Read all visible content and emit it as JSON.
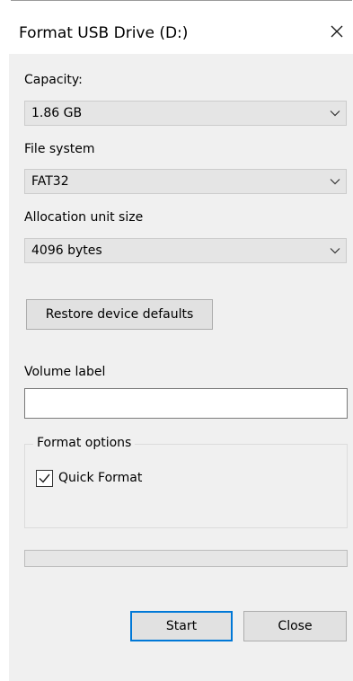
{
  "window": {
    "title": "Format USB Drive (D:)",
    "close_icon": "close-icon"
  },
  "capacity": {
    "label": "Capacity:",
    "value": "1.86 GB"
  },
  "file_system": {
    "label": "File system",
    "value": "FAT32"
  },
  "allocation": {
    "label": "Allocation unit size",
    "value": "4096 bytes"
  },
  "restore_button": "Restore device defaults",
  "volume": {
    "label": "Volume label",
    "value": ""
  },
  "format_options": {
    "legend": "Format options",
    "quick_format_label": "Quick Format",
    "quick_format_checked": true
  },
  "progress": {
    "fraction": 0
  },
  "buttons": {
    "start": "Start",
    "close": "Close"
  },
  "colors": {
    "dialog_bg": "#f0f0f0",
    "default_button_border": "#0078d7"
  }
}
